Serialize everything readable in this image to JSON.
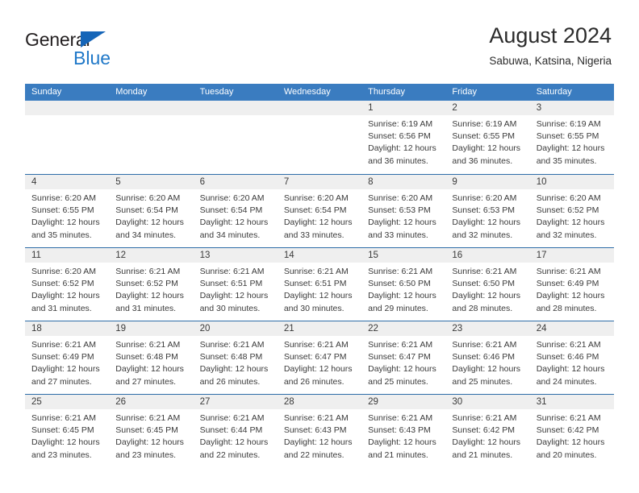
{
  "brand": {
    "name_part1": "General",
    "name_part2": "Blue",
    "triangle_color": "#1565b8",
    "blue_color": "#1f78c8"
  },
  "header": {
    "title": "August 2024",
    "location": "Sabuwa, Katsina, Nigeria"
  },
  "theme": {
    "header_row_bg": "#3a7cc0",
    "row_separator": "#2e6da8",
    "day_band_bg": "#efefef",
    "text": "#3a3a3a"
  },
  "weekdays": [
    "Sunday",
    "Monday",
    "Tuesday",
    "Wednesday",
    "Thursday",
    "Friday",
    "Saturday"
  ],
  "weeks": [
    [
      {
        "day": "",
        "sunrise": "",
        "sunset": "",
        "daylight1": "",
        "daylight2": ""
      },
      {
        "day": "",
        "sunrise": "",
        "sunset": "",
        "daylight1": "",
        "daylight2": ""
      },
      {
        "day": "",
        "sunrise": "",
        "sunset": "",
        "daylight1": "",
        "daylight2": ""
      },
      {
        "day": "",
        "sunrise": "",
        "sunset": "",
        "daylight1": "",
        "daylight2": ""
      },
      {
        "day": "1",
        "sunrise": "Sunrise: 6:19 AM",
        "sunset": "Sunset: 6:56 PM",
        "daylight1": "Daylight: 12 hours",
        "daylight2": "and 36 minutes."
      },
      {
        "day": "2",
        "sunrise": "Sunrise: 6:19 AM",
        "sunset": "Sunset: 6:55 PM",
        "daylight1": "Daylight: 12 hours",
        "daylight2": "and 36 minutes."
      },
      {
        "day": "3",
        "sunrise": "Sunrise: 6:19 AM",
        "sunset": "Sunset: 6:55 PM",
        "daylight1": "Daylight: 12 hours",
        "daylight2": "and 35 minutes."
      }
    ],
    [
      {
        "day": "4",
        "sunrise": "Sunrise: 6:20 AM",
        "sunset": "Sunset: 6:55 PM",
        "daylight1": "Daylight: 12 hours",
        "daylight2": "and 35 minutes."
      },
      {
        "day": "5",
        "sunrise": "Sunrise: 6:20 AM",
        "sunset": "Sunset: 6:54 PM",
        "daylight1": "Daylight: 12 hours",
        "daylight2": "and 34 minutes."
      },
      {
        "day": "6",
        "sunrise": "Sunrise: 6:20 AM",
        "sunset": "Sunset: 6:54 PM",
        "daylight1": "Daylight: 12 hours",
        "daylight2": "and 34 minutes."
      },
      {
        "day": "7",
        "sunrise": "Sunrise: 6:20 AM",
        "sunset": "Sunset: 6:54 PM",
        "daylight1": "Daylight: 12 hours",
        "daylight2": "and 33 minutes."
      },
      {
        "day": "8",
        "sunrise": "Sunrise: 6:20 AM",
        "sunset": "Sunset: 6:53 PM",
        "daylight1": "Daylight: 12 hours",
        "daylight2": "and 33 minutes."
      },
      {
        "day": "9",
        "sunrise": "Sunrise: 6:20 AM",
        "sunset": "Sunset: 6:53 PM",
        "daylight1": "Daylight: 12 hours",
        "daylight2": "and 32 minutes."
      },
      {
        "day": "10",
        "sunrise": "Sunrise: 6:20 AM",
        "sunset": "Sunset: 6:52 PM",
        "daylight1": "Daylight: 12 hours",
        "daylight2": "and 32 minutes."
      }
    ],
    [
      {
        "day": "11",
        "sunrise": "Sunrise: 6:20 AM",
        "sunset": "Sunset: 6:52 PM",
        "daylight1": "Daylight: 12 hours",
        "daylight2": "and 31 minutes."
      },
      {
        "day": "12",
        "sunrise": "Sunrise: 6:21 AM",
        "sunset": "Sunset: 6:52 PM",
        "daylight1": "Daylight: 12 hours",
        "daylight2": "and 31 minutes."
      },
      {
        "day": "13",
        "sunrise": "Sunrise: 6:21 AM",
        "sunset": "Sunset: 6:51 PM",
        "daylight1": "Daylight: 12 hours",
        "daylight2": "and 30 minutes."
      },
      {
        "day": "14",
        "sunrise": "Sunrise: 6:21 AM",
        "sunset": "Sunset: 6:51 PM",
        "daylight1": "Daylight: 12 hours",
        "daylight2": "and 30 minutes."
      },
      {
        "day": "15",
        "sunrise": "Sunrise: 6:21 AM",
        "sunset": "Sunset: 6:50 PM",
        "daylight1": "Daylight: 12 hours",
        "daylight2": "and 29 minutes."
      },
      {
        "day": "16",
        "sunrise": "Sunrise: 6:21 AM",
        "sunset": "Sunset: 6:50 PM",
        "daylight1": "Daylight: 12 hours",
        "daylight2": "and 28 minutes."
      },
      {
        "day": "17",
        "sunrise": "Sunrise: 6:21 AM",
        "sunset": "Sunset: 6:49 PM",
        "daylight1": "Daylight: 12 hours",
        "daylight2": "and 28 minutes."
      }
    ],
    [
      {
        "day": "18",
        "sunrise": "Sunrise: 6:21 AM",
        "sunset": "Sunset: 6:49 PM",
        "daylight1": "Daylight: 12 hours",
        "daylight2": "and 27 minutes."
      },
      {
        "day": "19",
        "sunrise": "Sunrise: 6:21 AM",
        "sunset": "Sunset: 6:48 PM",
        "daylight1": "Daylight: 12 hours",
        "daylight2": "and 27 minutes."
      },
      {
        "day": "20",
        "sunrise": "Sunrise: 6:21 AM",
        "sunset": "Sunset: 6:48 PM",
        "daylight1": "Daylight: 12 hours",
        "daylight2": "and 26 minutes."
      },
      {
        "day": "21",
        "sunrise": "Sunrise: 6:21 AM",
        "sunset": "Sunset: 6:47 PM",
        "daylight1": "Daylight: 12 hours",
        "daylight2": "and 26 minutes."
      },
      {
        "day": "22",
        "sunrise": "Sunrise: 6:21 AM",
        "sunset": "Sunset: 6:47 PM",
        "daylight1": "Daylight: 12 hours",
        "daylight2": "and 25 minutes."
      },
      {
        "day": "23",
        "sunrise": "Sunrise: 6:21 AM",
        "sunset": "Sunset: 6:46 PM",
        "daylight1": "Daylight: 12 hours",
        "daylight2": "and 25 minutes."
      },
      {
        "day": "24",
        "sunrise": "Sunrise: 6:21 AM",
        "sunset": "Sunset: 6:46 PM",
        "daylight1": "Daylight: 12 hours",
        "daylight2": "and 24 minutes."
      }
    ],
    [
      {
        "day": "25",
        "sunrise": "Sunrise: 6:21 AM",
        "sunset": "Sunset: 6:45 PM",
        "daylight1": "Daylight: 12 hours",
        "daylight2": "and 23 minutes."
      },
      {
        "day": "26",
        "sunrise": "Sunrise: 6:21 AM",
        "sunset": "Sunset: 6:45 PM",
        "daylight1": "Daylight: 12 hours",
        "daylight2": "and 23 minutes."
      },
      {
        "day": "27",
        "sunrise": "Sunrise: 6:21 AM",
        "sunset": "Sunset: 6:44 PM",
        "daylight1": "Daylight: 12 hours",
        "daylight2": "and 22 minutes."
      },
      {
        "day": "28",
        "sunrise": "Sunrise: 6:21 AM",
        "sunset": "Sunset: 6:43 PM",
        "daylight1": "Daylight: 12 hours",
        "daylight2": "and 22 minutes."
      },
      {
        "day": "29",
        "sunrise": "Sunrise: 6:21 AM",
        "sunset": "Sunset: 6:43 PM",
        "daylight1": "Daylight: 12 hours",
        "daylight2": "and 21 minutes."
      },
      {
        "day": "30",
        "sunrise": "Sunrise: 6:21 AM",
        "sunset": "Sunset: 6:42 PM",
        "daylight1": "Daylight: 12 hours",
        "daylight2": "and 21 minutes."
      },
      {
        "day": "31",
        "sunrise": "Sunrise: 6:21 AM",
        "sunset": "Sunset: 6:42 PM",
        "daylight1": "Daylight: 12 hours",
        "daylight2": "and 20 minutes."
      }
    ]
  ]
}
